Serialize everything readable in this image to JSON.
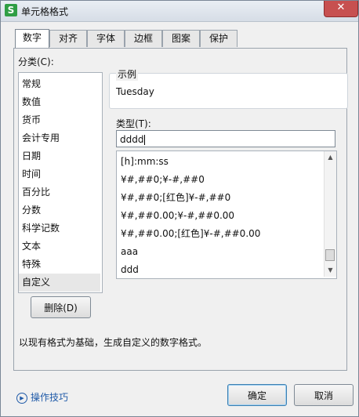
{
  "window": {
    "title": "单元格格式",
    "app_icon": "S",
    "close_glyph": "✕"
  },
  "tabs": [
    {
      "label": "数字",
      "active": true
    },
    {
      "label": "对齐",
      "active": false
    },
    {
      "label": "字体",
      "active": false
    },
    {
      "label": "边框",
      "active": false
    },
    {
      "label": "图案",
      "active": false
    },
    {
      "label": "保护",
      "active": false
    }
  ],
  "category": {
    "label": "分类(C):",
    "items": [
      "常规",
      "数值",
      "货币",
      "会计专用",
      "日期",
      "时间",
      "百分比",
      "分数",
      "科学记数",
      "文本",
      "特殊",
      "自定义"
    ],
    "selected": "自定义"
  },
  "sample": {
    "label": "示例",
    "value": "Tuesday"
  },
  "type": {
    "label": "类型(T):",
    "value": "dddd",
    "list": [
      "[h]:mm:ss",
      "¥#,##0;¥-#,##0",
      "¥#,##0;[红色]¥-#,##0",
      "¥#,##0.00;¥-#,##0.00",
      "¥#,##0.00;[红色]¥-#,##0.00",
      "aaa",
      "ddd"
    ]
  },
  "buttons": {
    "delete": "删除(D)",
    "ok": "确定",
    "cancel": "取消"
  },
  "hint": "以现有格式为基础，生成自定义的数字格式。",
  "footer": {
    "tips": "操作技巧"
  },
  "colors": {
    "accent": "#1f5aa8",
    "close": "#c75050"
  }
}
